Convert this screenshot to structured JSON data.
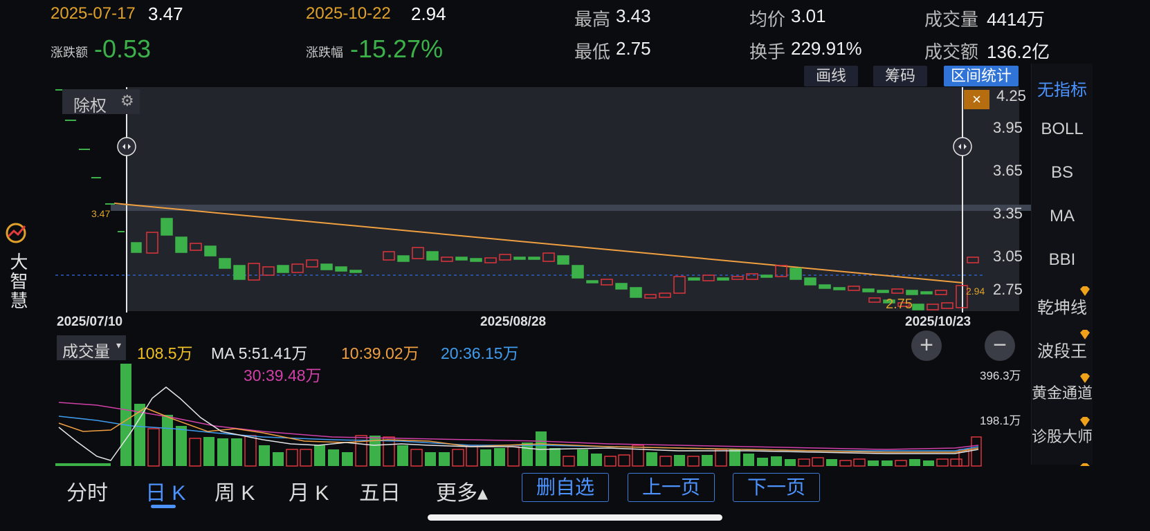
{
  "header": {
    "start_date": "2025-07-17",
    "start_value": "3.47",
    "end_date": "2025-10-22",
    "end_value": "2.94",
    "change_label": "涨跌额",
    "change_value": "-0.53",
    "pct_label": "涨跌幅",
    "pct_value": "-15.27%",
    "high_label": "最高",
    "high_value": "3.43",
    "low_label": "最低",
    "low_value": "2.75",
    "avg_label": "均价",
    "avg_value": "3.01",
    "turnover_label": "换手",
    "turnover_value": "229.91%",
    "volume_label": "成交量",
    "volume_value": "4414万",
    "amount_label": "成交额",
    "amount_value": "136.2亿"
  },
  "toolbar": {
    "draw_line": "画线",
    "chips": "筹码",
    "range_stats": "区间统计"
  },
  "app_logo": {
    "name": "大智慧"
  },
  "chart": {
    "adjust_label": "除权",
    "y_ticks": [
      "4.25",
      "3.95",
      "3.65",
      "3.35",
      "3.05",
      "2.75"
    ],
    "x_ticks": [
      "2025/07/10",
      "2025/08/28",
      "2025/10/23"
    ],
    "marker_left": "3.47",
    "marker_right": "2.94",
    "low_marker": "2.75",
    "close_label": "×"
  },
  "volume": {
    "selector_label": "成交量",
    "current": "108.5万",
    "ma5": "MA 5:51.41万",
    "ma10": "10:39.02万",
    "ma20": "20:36.15万",
    "ma30": "30:39.48万",
    "y_top": "396.3万",
    "y_mid": "198.1万"
  },
  "sidebar": {
    "items": [
      "无指标",
      "BOLL",
      "BS",
      "MA",
      "BBI",
      "乾坤线",
      "波段王",
      "黄金通道",
      "诊股大师"
    ]
  },
  "tabs": [
    "分时",
    "日 K",
    "周 K",
    "月 K",
    "五日",
    "更多▴"
  ],
  "actions": [
    "删自选",
    "上一页",
    "下一页"
  ],
  "zoom": {
    "plus": "+",
    "minus": "−"
  },
  "colors": {
    "up": "#e0343c",
    "down": "#3cb14a",
    "accent": "#2f74d6",
    "orange": "#e0a22a"
  },
  "chart_data": {
    "type": "candlestick",
    "x_labels": [
      "2025/07/10",
      "2025/08/28",
      "2025/10/23"
    ],
    "ylim": [
      2.7,
      4.3
    ]
  }
}
